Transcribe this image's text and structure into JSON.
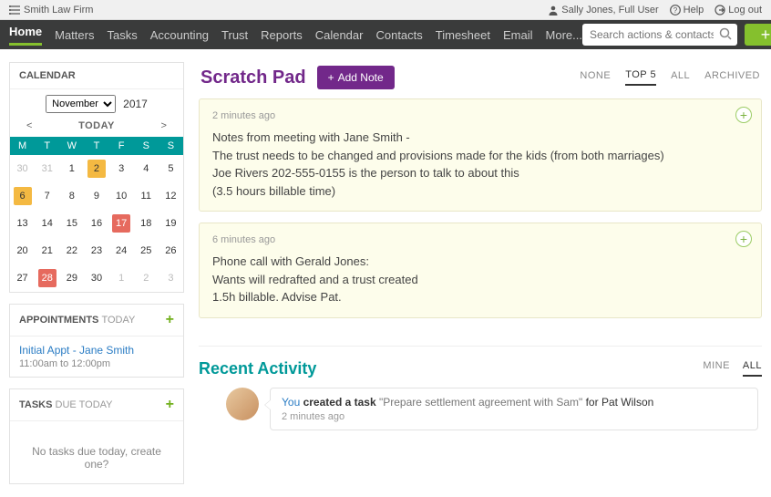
{
  "topbar": {
    "firm": "Smith Law Firm",
    "user": "Sally Jones, Full User",
    "help": "Help",
    "logout": "Log out"
  },
  "nav": {
    "items": [
      "Home",
      "Matters",
      "Tasks",
      "Accounting",
      "Trust",
      "Reports",
      "Calendar",
      "Contacts",
      "Timesheet",
      "Email",
      "More..."
    ],
    "active": 0,
    "search_placeholder": "Search actions & contacts"
  },
  "calendar": {
    "title": "CALENDAR",
    "month": "November",
    "year": "2017",
    "today_label": "TODAY",
    "dow": [
      "M",
      "T",
      "W",
      "T",
      "F",
      "S",
      "S"
    ],
    "weeks": [
      [
        {
          "d": "30",
          "other": true
        },
        {
          "d": "31",
          "other": true
        },
        {
          "d": "1"
        },
        {
          "d": "2",
          "hl": "orange"
        },
        {
          "d": "3"
        },
        {
          "d": "4"
        },
        {
          "d": "5"
        }
      ],
      [
        {
          "d": "6",
          "hl": "orange"
        },
        {
          "d": "7"
        },
        {
          "d": "8"
        },
        {
          "d": "9"
        },
        {
          "d": "10"
        },
        {
          "d": "11"
        },
        {
          "d": "12"
        }
      ],
      [
        {
          "d": "13"
        },
        {
          "d": "14"
        },
        {
          "d": "15"
        },
        {
          "d": "16"
        },
        {
          "d": "17",
          "hl": "red"
        },
        {
          "d": "18"
        },
        {
          "d": "19"
        }
      ],
      [
        {
          "d": "20"
        },
        {
          "d": "21"
        },
        {
          "d": "22"
        },
        {
          "d": "23"
        },
        {
          "d": "24"
        },
        {
          "d": "25"
        },
        {
          "d": "26"
        }
      ],
      [
        {
          "d": "27"
        },
        {
          "d": "28",
          "hl": "red"
        },
        {
          "d": "29"
        },
        {
          "d": "30"
        },
        {
          "d": "1",
          "other": true
        },
        {
          "d": "2",
          "other": true
        },
        {
          "d": "3",
          "other": true
        }
      ]
    ]
  },
  "appointments": {
    "title_strong": "APPOINTMENTS",
    "title_muted": "TODAY",
    "item_title": "Initial Appt - Jane Smith",
    "item_time": "11:00am to 12:00pm"
  },
  "tasks": {
    "title_strong": "TASKS",
    "title_muted": "DUE TODAY",
    "empty": "No tasks due today, create one?"
  },
  "scratch": {
    "title": "Scratch Pad",
    "add_note": "Add Note",
    "tabs": [
      "NONE",
      "TOP 5",
      "ALL",
      "ARCHIVED"
    ],
    "active_tab": 1,
    "notes": [
      {
        "time": "2 minutes ago",
        "lines": [
          "Notes from meeting with Jane Smith -",
          "The trust needs to be changed and provisions made for the kids (from both marriages)",
          "Joe Rivers 202-555-0155 is the person to talk to about this",
          "(3.5 hours billable time)"
        ]
      },
      {
        "time": "6 minutes ago",
        "lines": [
          "Phone call with Gerald Jones:",
          "Wants will redrafted and a trust created",
          "1.5h billable. Advise Pat."
        ]
      }
    ]
  },
  "recent": {
    "title": "Recent Activity",
    "tabs": [
      "MINE",
      "ALL"
    ],
    "active_tab": 1,
    "entry": {
      "you": "You",
      "action": " created a task ",
      "task": "\"Prepare settlement agreement with Sam\"",
      "for": " for ",
      "person": "Pat Wilson",
      "time": "2 minutes ago"
    }
  }
}
